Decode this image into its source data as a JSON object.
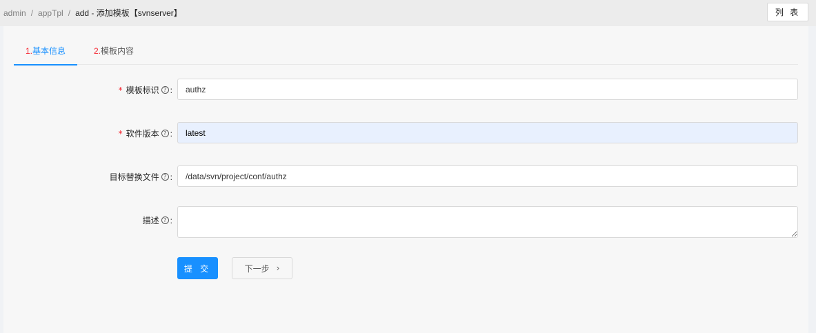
{
  "breadcrumb": {
    "items": [
      "admin",
      "appTpl"
    ],
    "separator": "/",
    "current": "add - 添加模板【svnserver】"
  },
  "header": {
    "list_button": "列 表"
  },
  "tabs": [
    {
      "num": "1.",
      "label": "基本信息",
      "active": true
    },
    {
      "num": "2.",
      "label": "模板内容",
      "active": false
    }
  ],
  "form": {
    "fields": [
      {
        "label": "模板标识",
        "required": true,
        "value": "authz"
      },
      {
        "label": "软件版本",
        "required": true,
        "value": "latest"
      },
      {
        "label": "目标替换文件",
        "required": false,
        "value": "/data/svn/project/conf/authz"
      },
      {
        "label": "描述",
        "required": false,
        "value": ""
      }
    ],
    "required_mark": "*",
    "help_glyph": "?",
    "colon": ":"
  },
  "buttons": {
    "submit": "提 交",
    "next": "下一步",
    "next_icon": "›"
  },
  "colors": {
    "primary": "#1890ff",
    "required": "#f5222d",
    "autofill": "#e8f0fe"
  },
  "icons": {
    "help": "question-circle-icon",
    "next": "chevron-right-icon"
  }
}
